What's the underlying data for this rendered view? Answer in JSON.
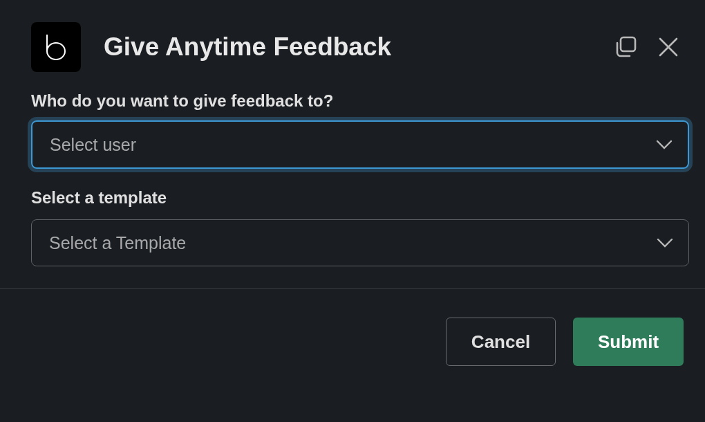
{
  "dialog": {
    "title": "Give Anytime Feedback"
  },
  "fields": [
    {
      "label": "Who do you want to give feedback to?",
      "placeholder": "Select user",
      "focused": true
    },
    {
      "label": "Select a template",
      "placeholder": "Select a Template",
      "focused": false
    }
  ],
  "buttons": [
    {
      "label": "Cancel",
      "kind": "secondary"
    },
    {
      "label": "Submit",
      "kind": "primary"
    }
  ]
}
